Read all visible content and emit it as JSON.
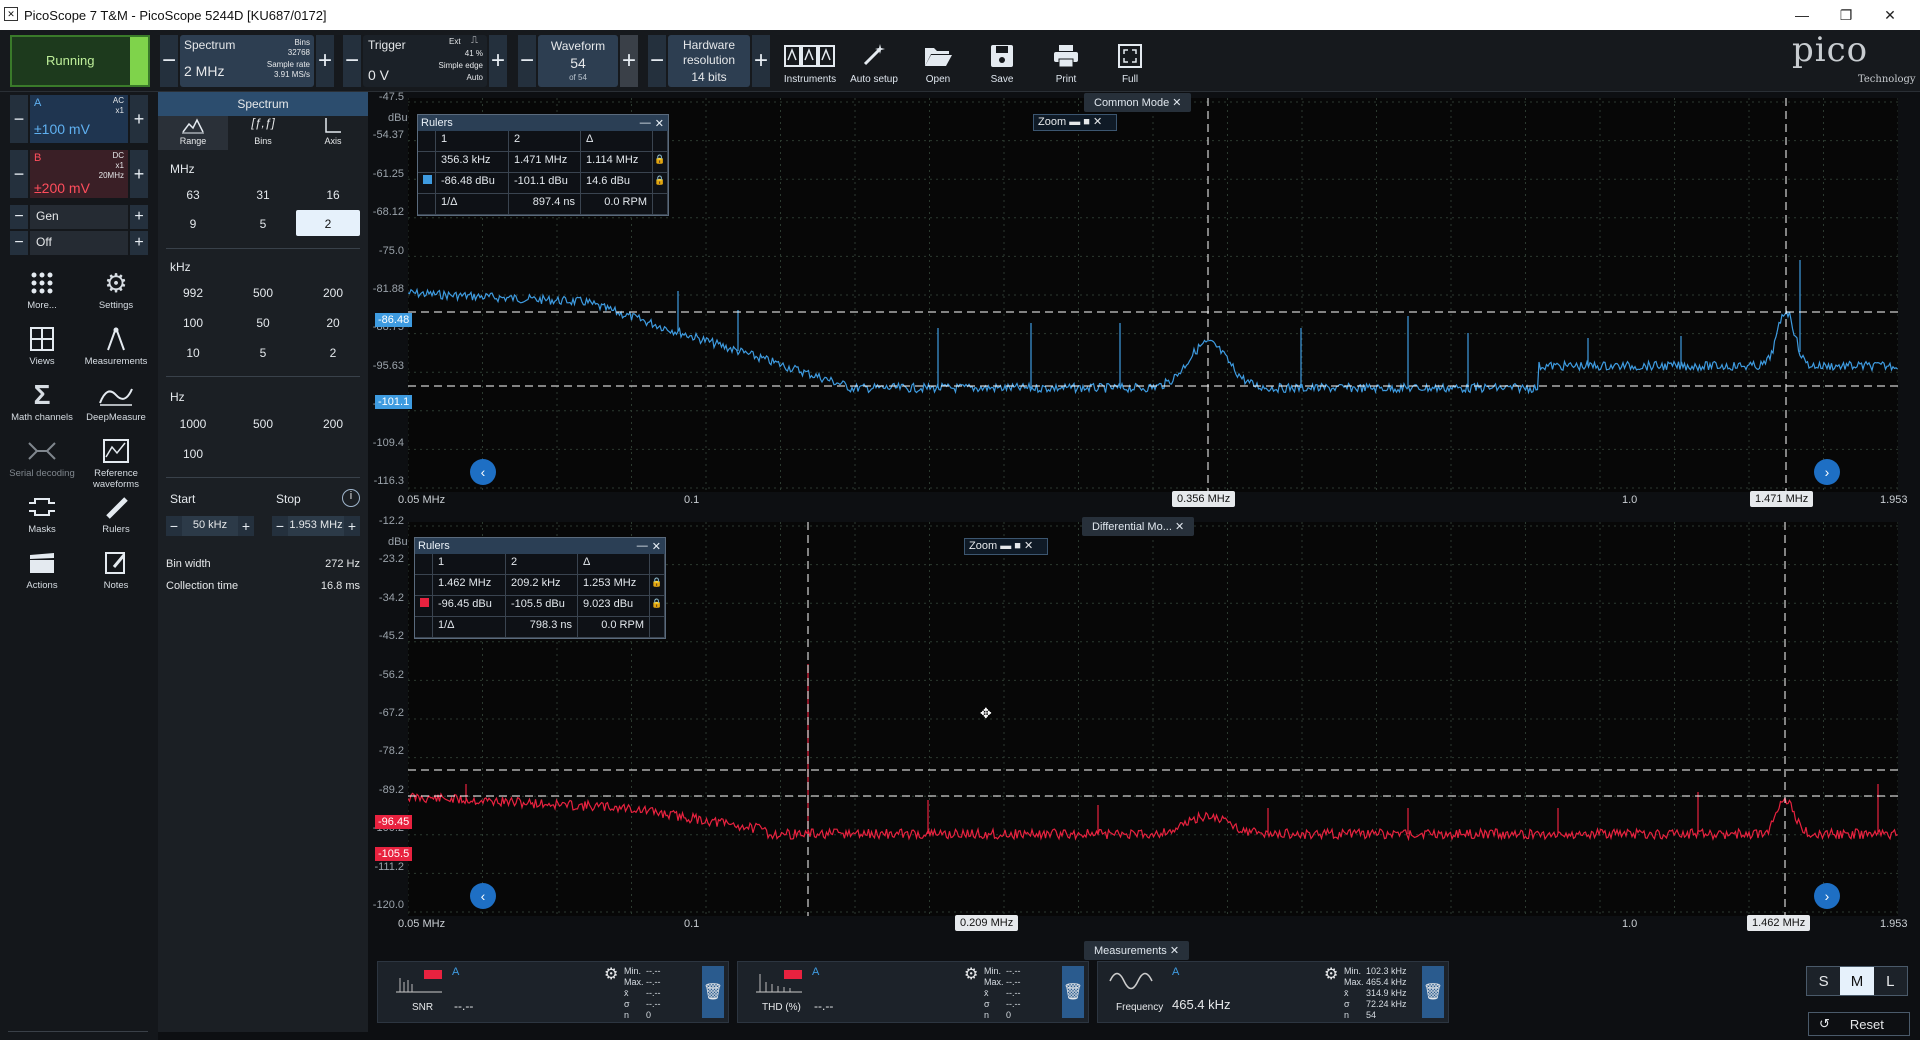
{
  "window": {
    "title": "PicoScope 7 T&M  - PicoScope 5244D [KU687/0172]"
  },
  "toolbar": {
    "running": "Running",
    "spectrum_label": "Spectrum",
    "spectrum_value": "2 MHz",
    "bins_label": "Bins",
    "bins_value": "32768",
    "sample_rate_label": "Sample rate",
    "sample_rate_value": "3.91 MS/s",
    "trigger_label": "Trigger",
    "trigger_value": "0 V",
    "trigger_source": "Ext",
    "trigger_pct": "41 %",
    "trigger_type": "Simple edge",
    "trigger_mode": "Auto",
    "waveform_label": "Waveform",
    "waveform_value": "54",
    "waveform_of": "of 54",
    "hwres_label_1": "Hardware",
    "hwres_label_2": "resolution",
    "hwres_value": "14 bits",
    "instruments": "Instruments",
    "autosetup": "Auto setup",
    "open": "Open",
    "save": "Save",
    "print": "Print",
    "full": "Full",
    "brand": "pico",
    "brand_sub": "Technology"
  },
  "channels": {
    "a_name": "A",
    "a_coupling": "AC",
    "a_probe": "x1",
    "a_range": "±100 mV",
    "b_name": "B",
    "b_coupling": "DC",
    "b_probe": "x1",
    "b_bw": "20MHz",
    "b_range": "±200 mV",
    "gen": "Gen",
    "off": "Off"
  },
  "nav": {
    "more": "More...",
    "settings": "Settings",
    "views": "Views",
    "measurements": "Measurements",
    "math": "Math channels",
    "deepmeasure": "DeepMeasure",
    "serial": "Serial decoding",
    "reference": "Reference waveforms",
    "masks": "Masks",
    "rulers": "Rulers",
    "actions": "Actions",
    "notes": "Notes"
  },
  "spectrum_panel": {
    "title": "Spectrum",
    "tab_range": "Range",
    "tab_bins": "Bins",
    "tab_axis": "Axis",
    "mhz_label": "MHz",
    "mhz": [
      "63",
      "31",
      "16",
      "9",
      "5",
      "2"
    ],
    "khz_label": "kHz",
    "khz": [
      "992",
      "500",
      "200",
      "100",
      "50",
      "20",
      "10",
      "5",
      "2"
    ],
    "hz_label": "Hz",
    "hz": [
      "1000",
      "500",
      "200",
      "100"
    ],
    "start_label": "Start",
    "stop_label": "Stop",
    "start_value": "50 kHz",
    "stop_value": "1.953 MHz",
    "binwidth_label": "Bin width",
    "binwidth_value": "272 Hz",
    "colltime_label": "Collection time",
    "colltime_value": "16.8 ms"
  },
  "graph1": {
    "tag": "Common Mode",
    "unit": "dBu",
    "yticks": [
      "-47.5",
      "-54.37",
      "-61.25",
      "-68.12",
      "-75.0",
      "-81.88",
      "-88.75",
      "-95.63",
      "-102.5",
      "-109.4",
      "-116.3"
    ],
    "xticks": [
      "0.05 MHz",
      "0.1",
      "1.0",
      "1.953"
    ],
    "marker_y1": "-86.48",
    "marker_y2": "-101.1",
    "marker_x1": "0.356 MHz",
    "marker_x2": "1.471 MHz",
    "zoom": "Zoom",
    "rulers": {
      "title": "Rulers",
      "h1": "1",
      "h2": "2",
      "h3": "Δ",
      "r1c1": "356.3 kHz",
      "r1c2": "1.471 MHz",
      "r1c3": "1.114 MHz",
      "r2c1": "-86.48 dBu",
      "r2c2": "-101.1 dBu",
      "r2c3": "14.6 dBu",
      "r3c1": "1/Δ",
      "r3c2": "897.4 ns",
      "r3c3": "0.0 RPM"
    }
  },
  "graph2": {
    "tag": "Differential Mo...",
    "unit": "dBu",
    "yticks": [
      "-12.2",
      "-23.2",
      "-34.2",
      "-45.2",
      "-56.2",
      "-67.2",
      "-78.2",
      "-89.2",
      "-100.2",
      "-111.2",
      "-120.0"
    ],
    "xticks": [
      "0.05 MHz",
      "0.1",
      "1.0",
      "1.953"
    ],
    "marker_y1": "-96.45",
    "marker_y2": "-105.5",
    "marker_x1": "0.209 MHz",
    "marker_x2": "1.462 MHz",
    "zoom": "Zoom",
    "rulers": {
      "title": "Rulers",
      "h1": "1",
      "h2": "2",
      "h3": "Δ",
      "r1c1": "1.462 MHz",
      "r1c2": "209.2 kHz",
      "r1c3": "1.253 MHz",
      "r2c1": "-96.45 dBu",
      "r2c2": "-105.5 dBu",
      "r2c3": "9.023 dBu",
      "r3c1": "1/Δ",
      "r3c2": "798.3 ns",
      "r3c3": "0.0 RPM"
    }
  },
  "measurements": {
    "tag": "Measurements",
    "m1_name": "SNR",
    "m1_ch": "A",
    "m1_value": "--.--",
    "m2_name": "THD (%)",
    "m2_ch": "A",
    "m2_value": "--.--",
    "m3_name": "Frequency",
    "m3_ch": "A",
    "m3_value": "465.4 kHz",
    "stat_labels": [
      "Min.",
      "Max.",
      "x̄",
      "σ",
      "n"
    ],
    "m1_stats": [
      "--.--",
      "--.--",
      "--.--",
      "--.--",
      "0"
    ],
    "m2_stats": [
      "--.--",
      "--.--",
      "--.--",
      "--.--",
      "0"
    ],
    "m3_stats": [
      "102.3 kHz",
      "465.4 kHz",
      "314.9 kHz",
      "72.24 kHz",
      "54"
    ],
    "size_s": "S",
    "size_m": "M",
    "size_l": "L",
    "reset": "Reset"
  },
  "colors": {
    "channel_a": "#3e9be0",
    "channel_b": "#e8223f",
    "accent": "#1e6fc4"
  }
}
